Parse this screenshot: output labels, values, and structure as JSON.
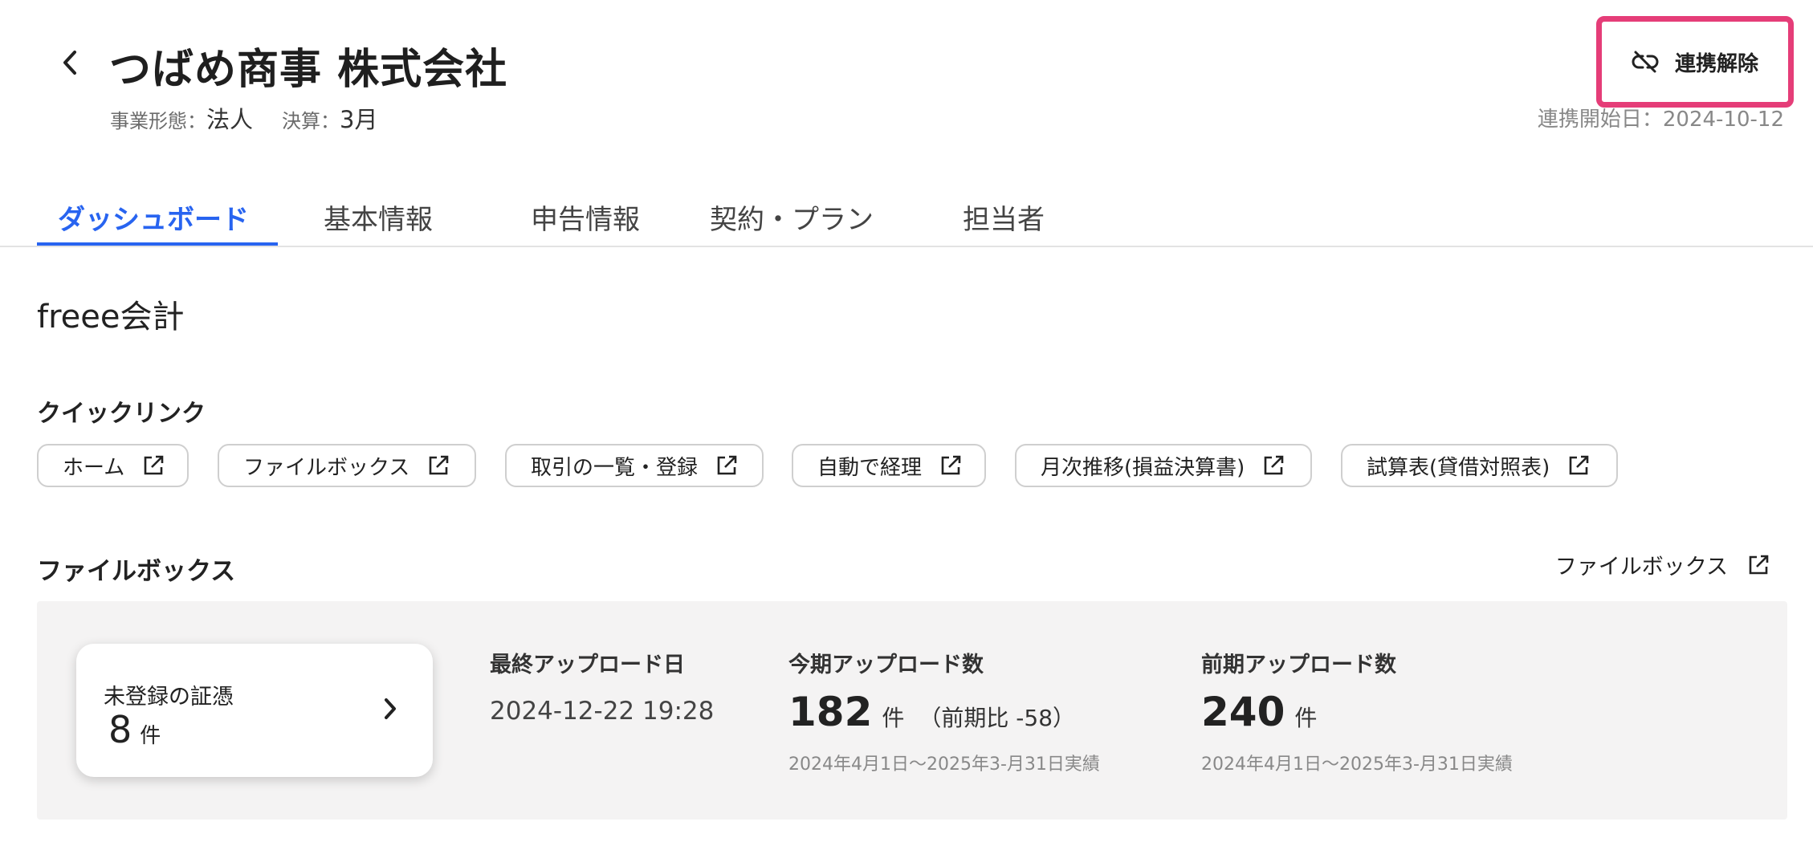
{
  "header": {
    "company_name": "つばめ商事 株式会社",
    "business_type_label": "事業形態：",
    "business_type_value": "法人",
    "fiscal_label": "決算：",
    "fiscal_value": "3月",
    "unlink_label": "連携解除",
    "link_start": "連携開始日：2024-10-12"
  },
  "tabs": [
    {
      "label": "ダッシュボード",
      "active": true
    },
    {
      "label": "基本情報",
      "active": false
    },
    {
      "label": "申告情報",
      "active": false
    },
    {
      "label": "契約・プラン",
      "active": false
    },
    {
      "label": "担当者",
      "active": false
    }
  ],
  "main": {
    "app_title": "freee会計",
    "quicklinks_title": "クイックリンク",
    "quicklinks": [
      {
        "label": "ホーム"
      },
      {
        "label": "ファイルボックス"
      },
      {
        "label": "取引の一覧・登録"
      },
      {
        "label": "自動で経理"
      },
      {
        "label": "月次推移(損益決算書)"
      },
      {
        "label": "試算表(貸借対照表)"
      }
    ],
    "filebox": {
      "title": "ファイルボックス",
      "link_label": "ファイルボックス",
      "unregistered": {
        "title": "未登録の証憑",
        "count": "8",
        "unit": "件"
      },
      "last_upload": {
        "label": "最終アップロード日",
        "value": "2024-12-22 19:28"
      },
      "current": {
        "label": "今期アップロード数",
        "value": "182",
        "unit": "件",
        "comparison": "（前期比 -58）",
        "period": "2024年4月1日〜2025年3-月31日実績"
      },
      "previous": {
        "label": "前期アップロード数",
        "value": "240",
        "unit": "件",
        "period": "2024年4月1日〜2025年3-月31日実績"
      }
    }
  },
  "colors": {
    "accent": "#2864f0",
    "highlight_border": "#e53d78",
    "panel_bg": "#f4f3f3"
  },
  "icons": {
    "back": "chevron-left-icon",
    "unlink": "unlink-icon",
    "external": "external-link-icon",
    "card_arrow": "chevron-right-icon"
  }
}
